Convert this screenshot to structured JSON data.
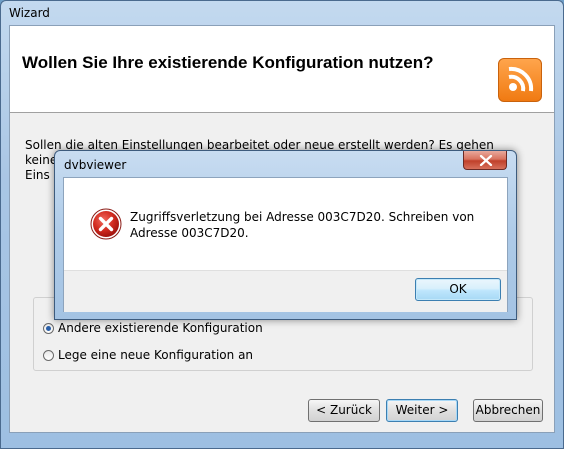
{
  "wizard": {
    "title": "Wizard",
    "heading": "Wollen Sie Ihre existierende Konfiguration nutzen?",
    "description_line1": "Sollen die alten Einstellungen bearbeitet oder neue erstellt werden? Es gehen keine",
    "description_line2": "Eins",
    "options": [
      {
        "label": "Andere existierende Konfiguration",
        "checked": true
      },
      {
        "label": "Lege eine neue Konfiguration an",
        "checked": false
      }
    ],
    "buttons": {
      "back": "< Zurück",
      "next": "Weiter >",
      "cancel": "Abbrechen"
    }
  },
  "dialog": {
    "title": "dvbviewer",
    "message": "Zugriffsverletzung bei Adresse 003C7D20. Schreiben von Adresse 003C7D20.",
    "ok_label": "OK",
    "icon": "error-icon"
  },
  "colors": {
    "accent_orange": "#f07a12",
    "error_red": "#c62020",
    "close_red": "#c0402a"
  }
}
